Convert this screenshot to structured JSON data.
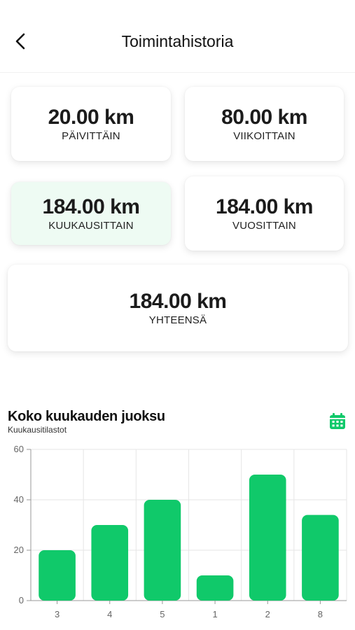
{
  "header": {
    "title": "Toimintahistoria",
    "back_icon": "chevron-left-icon"
  },
  "stats": {
    "daily": {
      "value": "20.00 km",
      "label": "PÄIVITTÄIN"
    },
    "weekly": {
      "value": "80.00 km",
      "label": "VIIKOITTAIN"
    },
    "monthly": {
      "value": "184.00 km",
      "label": "KUUKAUSITTAIN"
    },
    "yearly": {
      "value": "184.00 km",
      "label": "VUOSITTAIN"
    },
    "total": {
      "value": "184.00 km",
      "label": "YHTEENSÄ"
    }
  },
  "section": {
    "title": "Koko kuukauden juoksu",
    "subtitle": "Kuukausitilastot",
    "calendar_icon": "calendar-icon"
  },
  "colors": {
    "accent": "#10c96a",
    "active_card": "#eefbf3"
  },
  "chart_data": {
    "type": "bar",
    "categories": [
      "3",
      "4",
      "5",
      "1",
      "2",
      "8"
    ],
    "values": [
      20,
      30,
      40,
      10,
      50,
      34
    ],
    "ylim": [
      0,
      60
    ],
    "yticks": [
      0,
      20,
      40,
      60
    ],
    "grid": true
  }
}
